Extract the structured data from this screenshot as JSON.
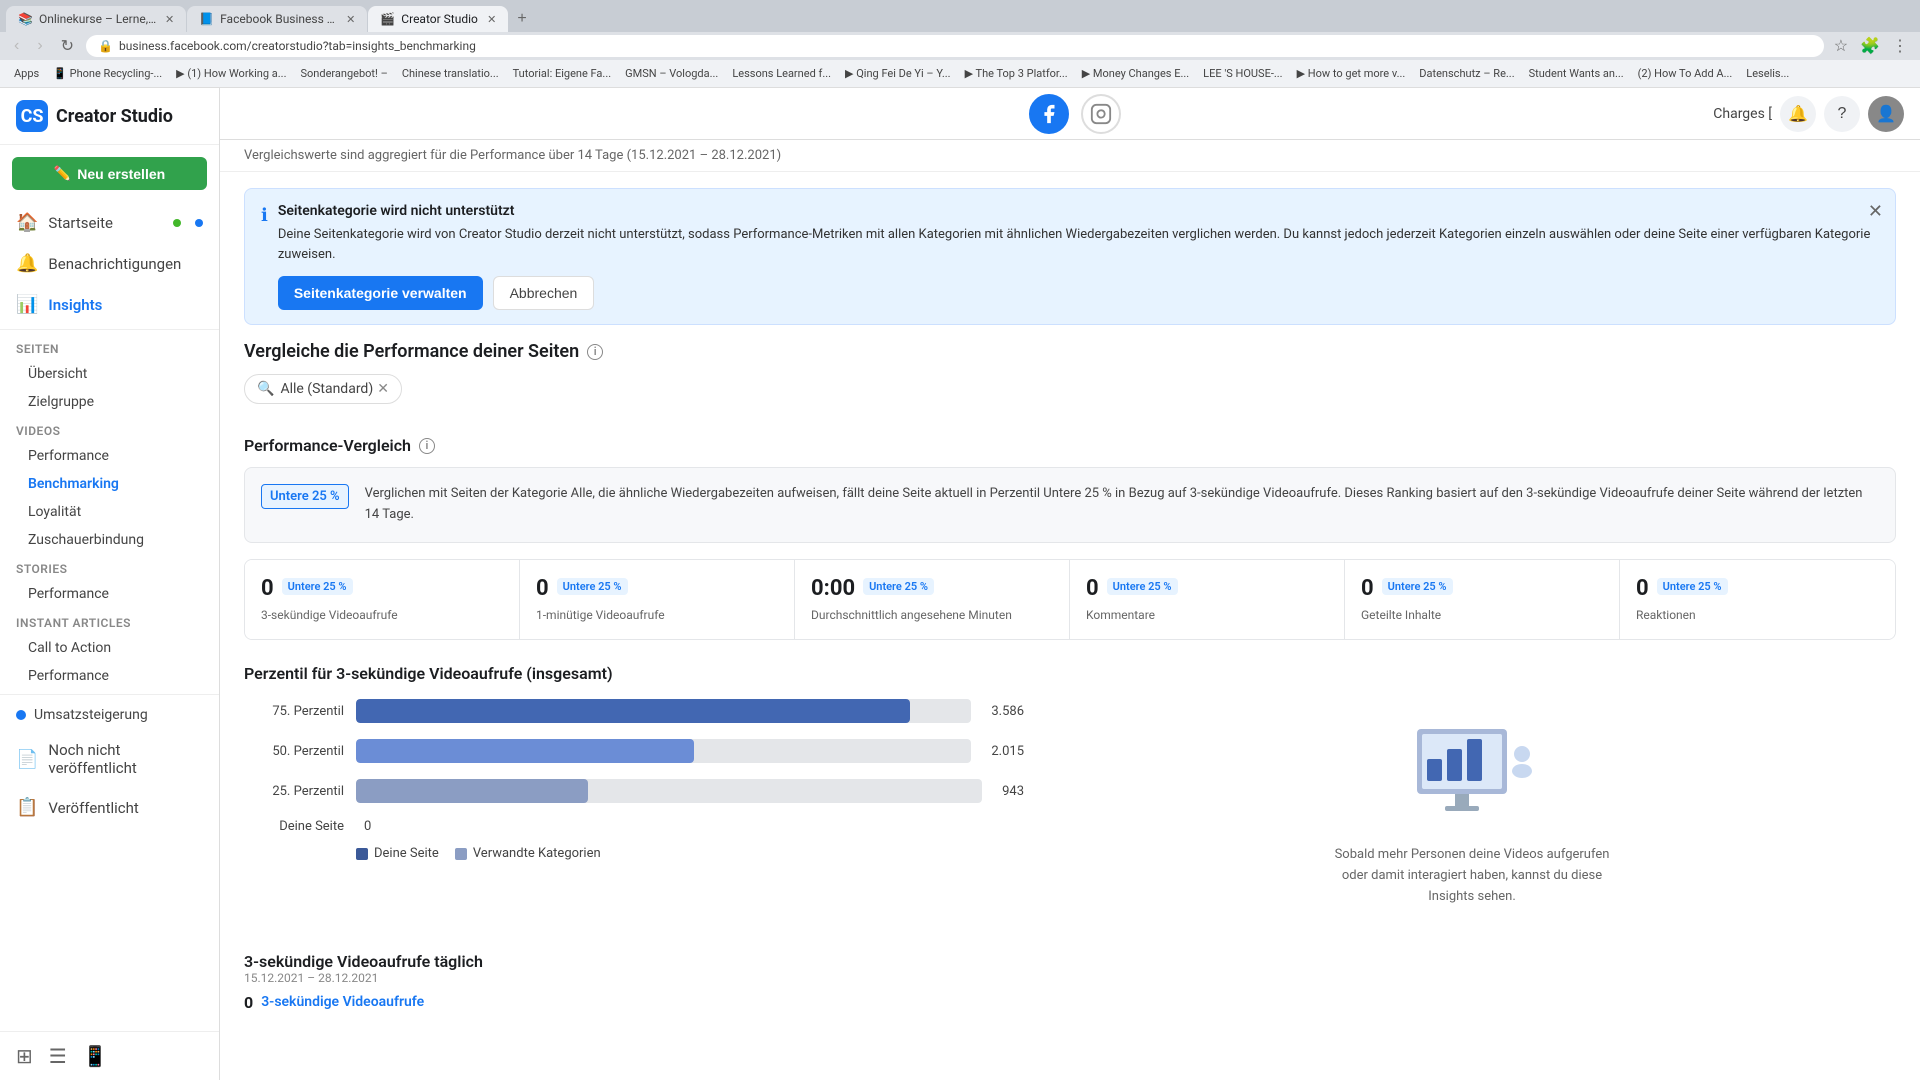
{
  "browser": {
    "tabs": [
      {
        "id": "tab1",
        "label": "Onlinekurse – Lerne, was un...",
        "active": false,
        "favicon": "📚"
      },
      {
        "id": "tab2",
        "label": "Facebook Business Suite",
        "active": false,
        "favicon": "📘"
      },
      {
        "id": "tab3",
        "label": "Creator Studio",
        "active": true,
        "favicon": "🎬"
      }
    ],
    "url": "business.facebook.com/creatorstudio?tab=insights_benchmarking",
    "bookmarks": [
      "Apps",
      "Phone Recycling-...",
      "(1) How Working a...",
      "Sonderangebot! –",
      "Chinese translatio...",
      "Tutorial: Eigene Fa...",
      "GMSN – Vologda...",
      "Lessons Learned f...",
      "Qing Fei De Yi – Y...",
      "The Top 3 Platfor...",
      "Money Changes E...",
      "LEE 'S HOUSE-...",
      "How to get more v...",
      "Datenschutz – Re...",
      "Student Wants an...",
      "(2) How To Add A...",
      "Leselis..."
    ]
  },
  "topbar": {
    "title": "Creator Studio",
    "charges_link": "Charges [",
    "platform_facebook_label": "Facebook",
    "platform_instagram_label": "Instagram"
  },
  "sidebar": {
    "create_button": "Neu erstellen",
    "nav_items": [
      {
        "id": "startseite",
        "label": "Startseite",
        "icon": "🏠",
        "has_dot": true,
        "online": true
      },
      {
        "id": "benachrichtigungen",
        "label": "Benachrichtigungen",
        "icon": "🔔",
        "has_dot": false
      },
      {
        "id": "insights",
        "label": "Insights",
        "icon": "📊",
        "active": true,
        "has_dot": false
      }
    ],
    "sections": [
      {
        "title": "Seiten",
        "items": [
          {
            "id": "uebersicht",
            "label": "Übersicht",
            "active": false
          },
          {
            "id": "zielgruppe",
            "label": "Zielgruppe",
            "active": false
          }
        ]
      },
      {
        "title": "Videos",
        "items": [
          {
            "id": "performance-videos",
            "label": "Performance",
            "active": false
          },
          {
            "id": "benchmarking",
            "label": "Benchmarking",
            "active": true
          },
          {
            "id": "loyalitaet",
            "label": "Loyalität",
            "active": false
          },
          {
            "id": "zuschauerbindung",
            "label": "Zuschauerbindung",
            "active": false
          }
        ]
      },
      {
        "title": "Stories",
        "items": [
          {
            "id": "performance-stories",
            "label": "Performance",
            "active": false
          }
        ]
      },
      {
        "title": "Instant Articles",
        "items": [
          {
            "id": "call-to-action",
            "label": "Call to Action",
            "active": false
          },
          {
            "id": "performance-articles",
            "label": "Performance",
            "active": false
          }
        ]
      }
    ],
    "bottom_items": [
      {
        "id": "umsatzsteigerung",
        "label": "Umsatzsteigerung",
        "has_dot": true
      },
      {
        "id": "noch-nicht",
        "label": "Noch nicht veröffentlicht",
        "icon": "📄"
      },
      {
        "id": "veroeffentlicht",
        "label": "Veröffentlicht",
        "icon": "📋"
      }
    ],
    "footer_icons": [
      {
        "id": "grid-icon",
        "label": "Grid"
      },
      {
        "id": "table-icon",
        "label": "Table"
      },
      {
        "id": "phone-icon",
        "label": "Phone"
      }
    ]
  },
  "main": {
    "compare_header": "Vergleichswerte sind aggregiert für die Performance über 14 Tage (15.12.2021 – 28.12.2021)",
    "alert": {
      "title": "Seitenkategorie wird nicht unterstützt",
      "text": "Deine Seitenkategorie wird von Creator Studio derzeit nicht unterstützt, sodass Performance-Metriken mit allen Kategorien mit ähnlichen Wiedergabezeiten verglichen werden. Du kannst jedoch jederzeit Kategorien einzeln auswählen oder deine Seite einer verfügbaren Kategorie zuweisen.",
      "btn_primary": "Seitenkategorie verwalten",
      "btn_secondary": "Abbrechen"
    },
    "compare_title": "Vergleiche die Performance deiner Seiten",
    "search_tag": "Alle (Standard)",
    "perf_vergleich": {
      "title": "Performance-Vergleich",
      "badge": "Untere 25 %",
      "description": "Verglichen mit Seiten der Kategorie Alle, die ähnliche Wiedergabezeiten aufweisen, fällt deine Seite aktuell in Perzentil Untere 25 % in Bezug auf 3-sekündige Videoaufrufe. Dieses Ranking basiert auf den 3-sekündige Videoaufrufe deiner Seite während der letzten 14 Tage."
    },
    "metrics": [
      {
        "value": "0",
        "badge": "Untere 25 %",
        "label": "3-sekündige Videoaufrufe"
      },
      {
        "value": "0",
        "badge": "Untere 25 %",
        "label": "1-minütige Videoaufrufe"
      },
      {
        "value": "0:00",
        "badge": "Untere 25 %",
        "label": "Durchschnittlich angesehene Minuten"
      },
      {
        "value": "0",
        "badge": "Untere 25 %",
        "label": "Kommentare"
      },
      {
        "value": "0",
        "badge": "Untere 25 %",
        "label": "Geteilte Inhalte"
      },
      {
        "value": "0",
        "badge": "Untere 25 %",
        "label": "Reaktionen"
      }
    ],
    "percentile_section": {
      "title": "Perzentil für 3-sekündige Videoaufrufe (insgesamt)",
      "bars": [
        {
          "label": "75. Perzentil",
          "value": 3586,
          "display": "3.586",
          "width_pct": 90
        },
        {
          "label": "50. Perzentil",
          "value": 2015,
          "display": "2.015",
          "width_pct": 55
        },
        {
          "label": "25. Perzentil",
          "value": 943,
          "display": "943",
          "width_pct": 37
        }
      ],
      "my_page_label": "Deine Seite",
      "my_page_value": "0",
      "legend_my_page": "Deine Seite",
      "legend_related": "Verwandte Kategorien",
      "placeholder_text": "Sobald mehr Personen deine Videos aufgerufen oder damit interagiert haben, kannst du diese Insights sehen."
    },
    "daily_section": {
      "title": "3-sekündige Videoaufrufe täglich",
      "date_range": "15.12.2021 – 28.12.2021",
      "value": "0",
      "link_label": "3-sekündige Videoaufrufe"
    }
  }
}
